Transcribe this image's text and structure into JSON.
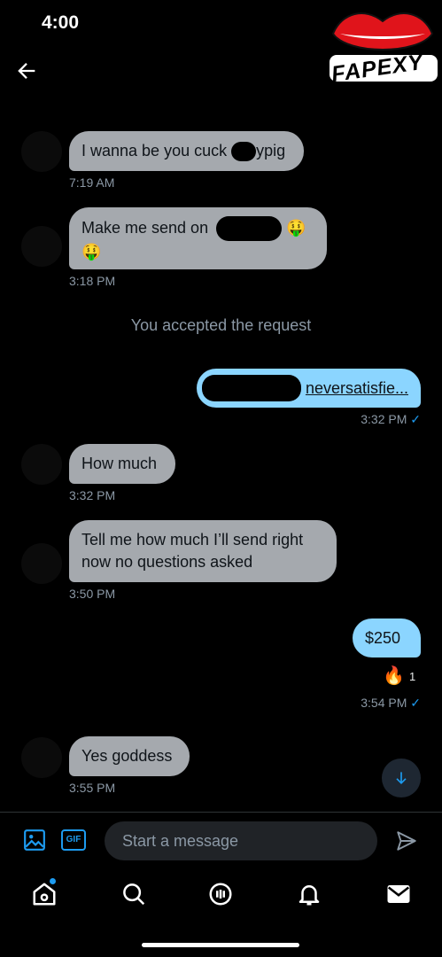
{
  "status": {
    "time": "4:00"
  },
  "logo": {
    "text": "FAPEXY"
  },
  "messages": [
    {
      "text": "I wanna be you cuck",
      "text2": "ypig",
      "time": "7:19 AM"
    },
    {
      "text": "Make me send on",
      "emoji": "🤑",
      "emoji2": "🤑",
      "time": "3:18 PM"
    },
    {
      "system": "You accepted the request"
    },
    {
      "link": "neversatisfie...",
      "time": "3:32 PM",
      "check": "✓"
    },
    {
      "text": "How much",
      "time": "3:32 PM"
    },
    {
      "line1": "Tell me how much I’ll send right",
      "line2": "now no questions asked",
      "time": "3:50 PM"
    },
    {
      "text": "$250",
      "reaction": "🔥",
      "reaction_count": "1",
      "time": "3:54 PM",
      "check": "✓"
    },
    {
      "text": "Yes goddess",
      "time": "3:55 PM"
    }
  ],
  "composer": {
    "placeholder": "Start a message",
    "gif_label": "GIF"
  },
  "colors": {
    "incoming": "#a5a9ae",
    "outgoing": "#8bd5ff",
    "accent": "#1d9bf0"
  }
}
